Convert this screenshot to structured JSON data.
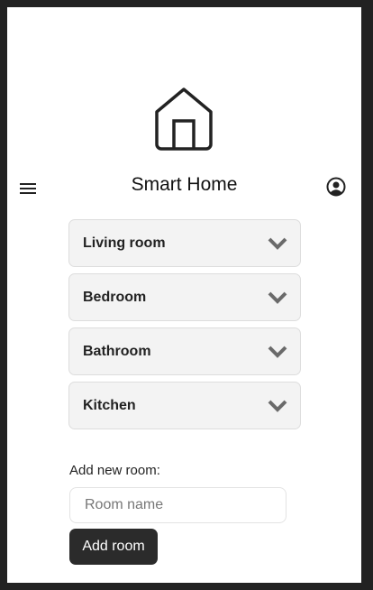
{
  "header": {
    "title": "Smart Home"
  },
  "rooms": [
    {
      "label": "Living room"
    },
    {
      "label": "Bedroom"
    },
    {
      "label": "Bathroom"
    },
    {
      "label": "Kitchen"
    }
  ],
  "add_room": {
    "label": "Add new room:",
    "placeholder": "Room name",
    "value": "",
    "button_label": "Add room"
  }
}
